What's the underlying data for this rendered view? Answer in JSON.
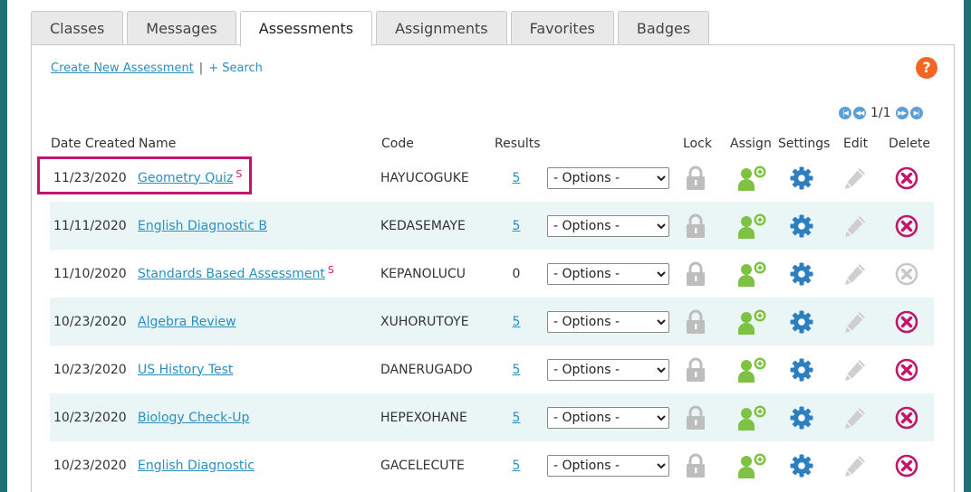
{
  "tabs": [
    "Classes",
    "Messages",
    "Assessments",
    "Assignments",
    "Favorites",
    "Badges"
  ],
  "active_tab": 2,
  "links": {
    "create": "Create New Assessment",
    "separator": "|",
    "search": "+ Search"
  },
  "help_label": "?",
  "pager": {
    "text": "1/1"
  },
  "headers": {
    "date": "Date Created",
    "name": "Name",
    "code": "Code",
    "results": "Results",
    "lock": "Lock",
    "assign": "Assign",
    "settings": "Settings",
    "edit": "Edit",
    "delete": "Delete"
  },
  "options_label": "- Options -",
  "rows": [
    {
      "date": "11/23/2020",
      "name": "Geometry Quiz",
      "flag": "S",
      "code": "HAYUCOGUKE",
      "results": "5",
      "results_link": true,
      "delete_active": true
    },
    {
      "date": "11/11/2020",
      "name": "English Diagnostic B",
      "flag": "",
      "code": "KEDASEMAYE",
      "results": "5",
      "results_link": true,
      "delete_active": true
    },
    {
      "date": "11/10/2020",
      "name": "Standards Based Assessment",
      "flag": "S",
      "code": "KEPANOLUCU",
      "results": "0",
      "results_link": false,
      "delete_active": false
    },
    {
      "date": "10/23/2020",
      "name": "Algebra Review",
      "flag": "",
      "code": "XUHORUTOYE",
      "results": "5",
      "results_link": true,
      "delete_active": true
    },
    {
      "date": "10/23/2020",
      "name": "US History Test",
      "flag": "",
      "code": "DANERUGADO",
      "results": "5",
      "results_link": true,
      "delete_active": true
    },
    {
      "date": "10/23/2020",
      "name": "Biology Check-Up",
      "flag": "",
      "code": "HEPEXOHANE",
      "results": "5",
      "results_link": true,
      "delete_active": true
    },
    {
      "date": "10/23/2020",
      "name": "English Diagnostic",
      "flag": "",
      "code": "GACELECUTE",
      "results": "5",
      "results_link": true,
      "delete_active": true
    }
  ],
  "colors": {
    "link": "#2a8fbd",
    "assign": "#7dc242",
    "settings": "#2d7fc1",
    "delete": "#c2166b",
    "delete_disabled": "#c8c8c8",
    "highlight": "#c2166b"
  }
}
